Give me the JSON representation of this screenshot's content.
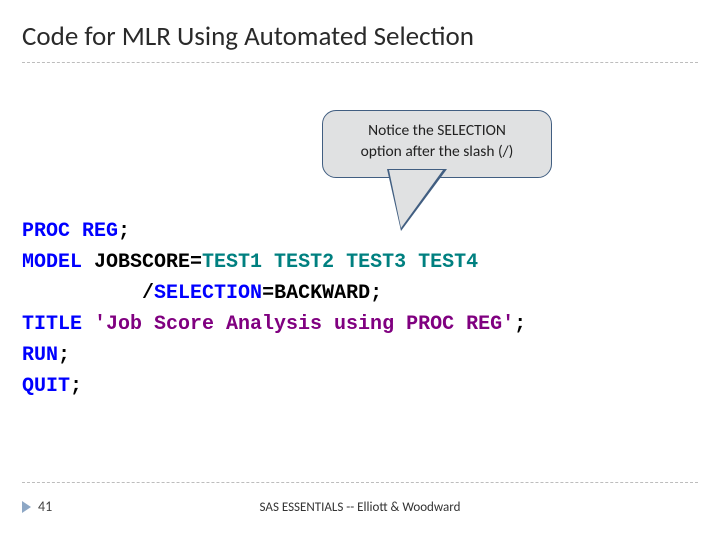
{
  "title": "Code for MLR Using Automated Selection",
  "callout": {
    "line1": "Notice the SELECTION",
    "line2": "option after the slash (/)"
  },
  "code": {
    "l1a": "PROC ",
    "l1b": "REG",
    "l1c": ";",
    "l2a": "MODEL ",
    "l2b": "JOBSCORE",
    "l2c": "=",
    "l2d": "TEST1 TEST2 TEST3 TEST4",
    "l3a": "          /",
    "l3b": "SELECTION",
    "l3c": "=BACKWARD;",
    "l4a": "TITLE ",
    "l4b": "'Job Score Analysis using PROC REG'",
    "l4c": ";",
    "l5": "RUN",
    "l5b": ";",
    "l6": "QUIT",
    "l6b": ";"
  },
  "footer": {
    "page": "41",
    "text": "SAS ESSENTIALS -- Elliott & Woodward"
  }
}
